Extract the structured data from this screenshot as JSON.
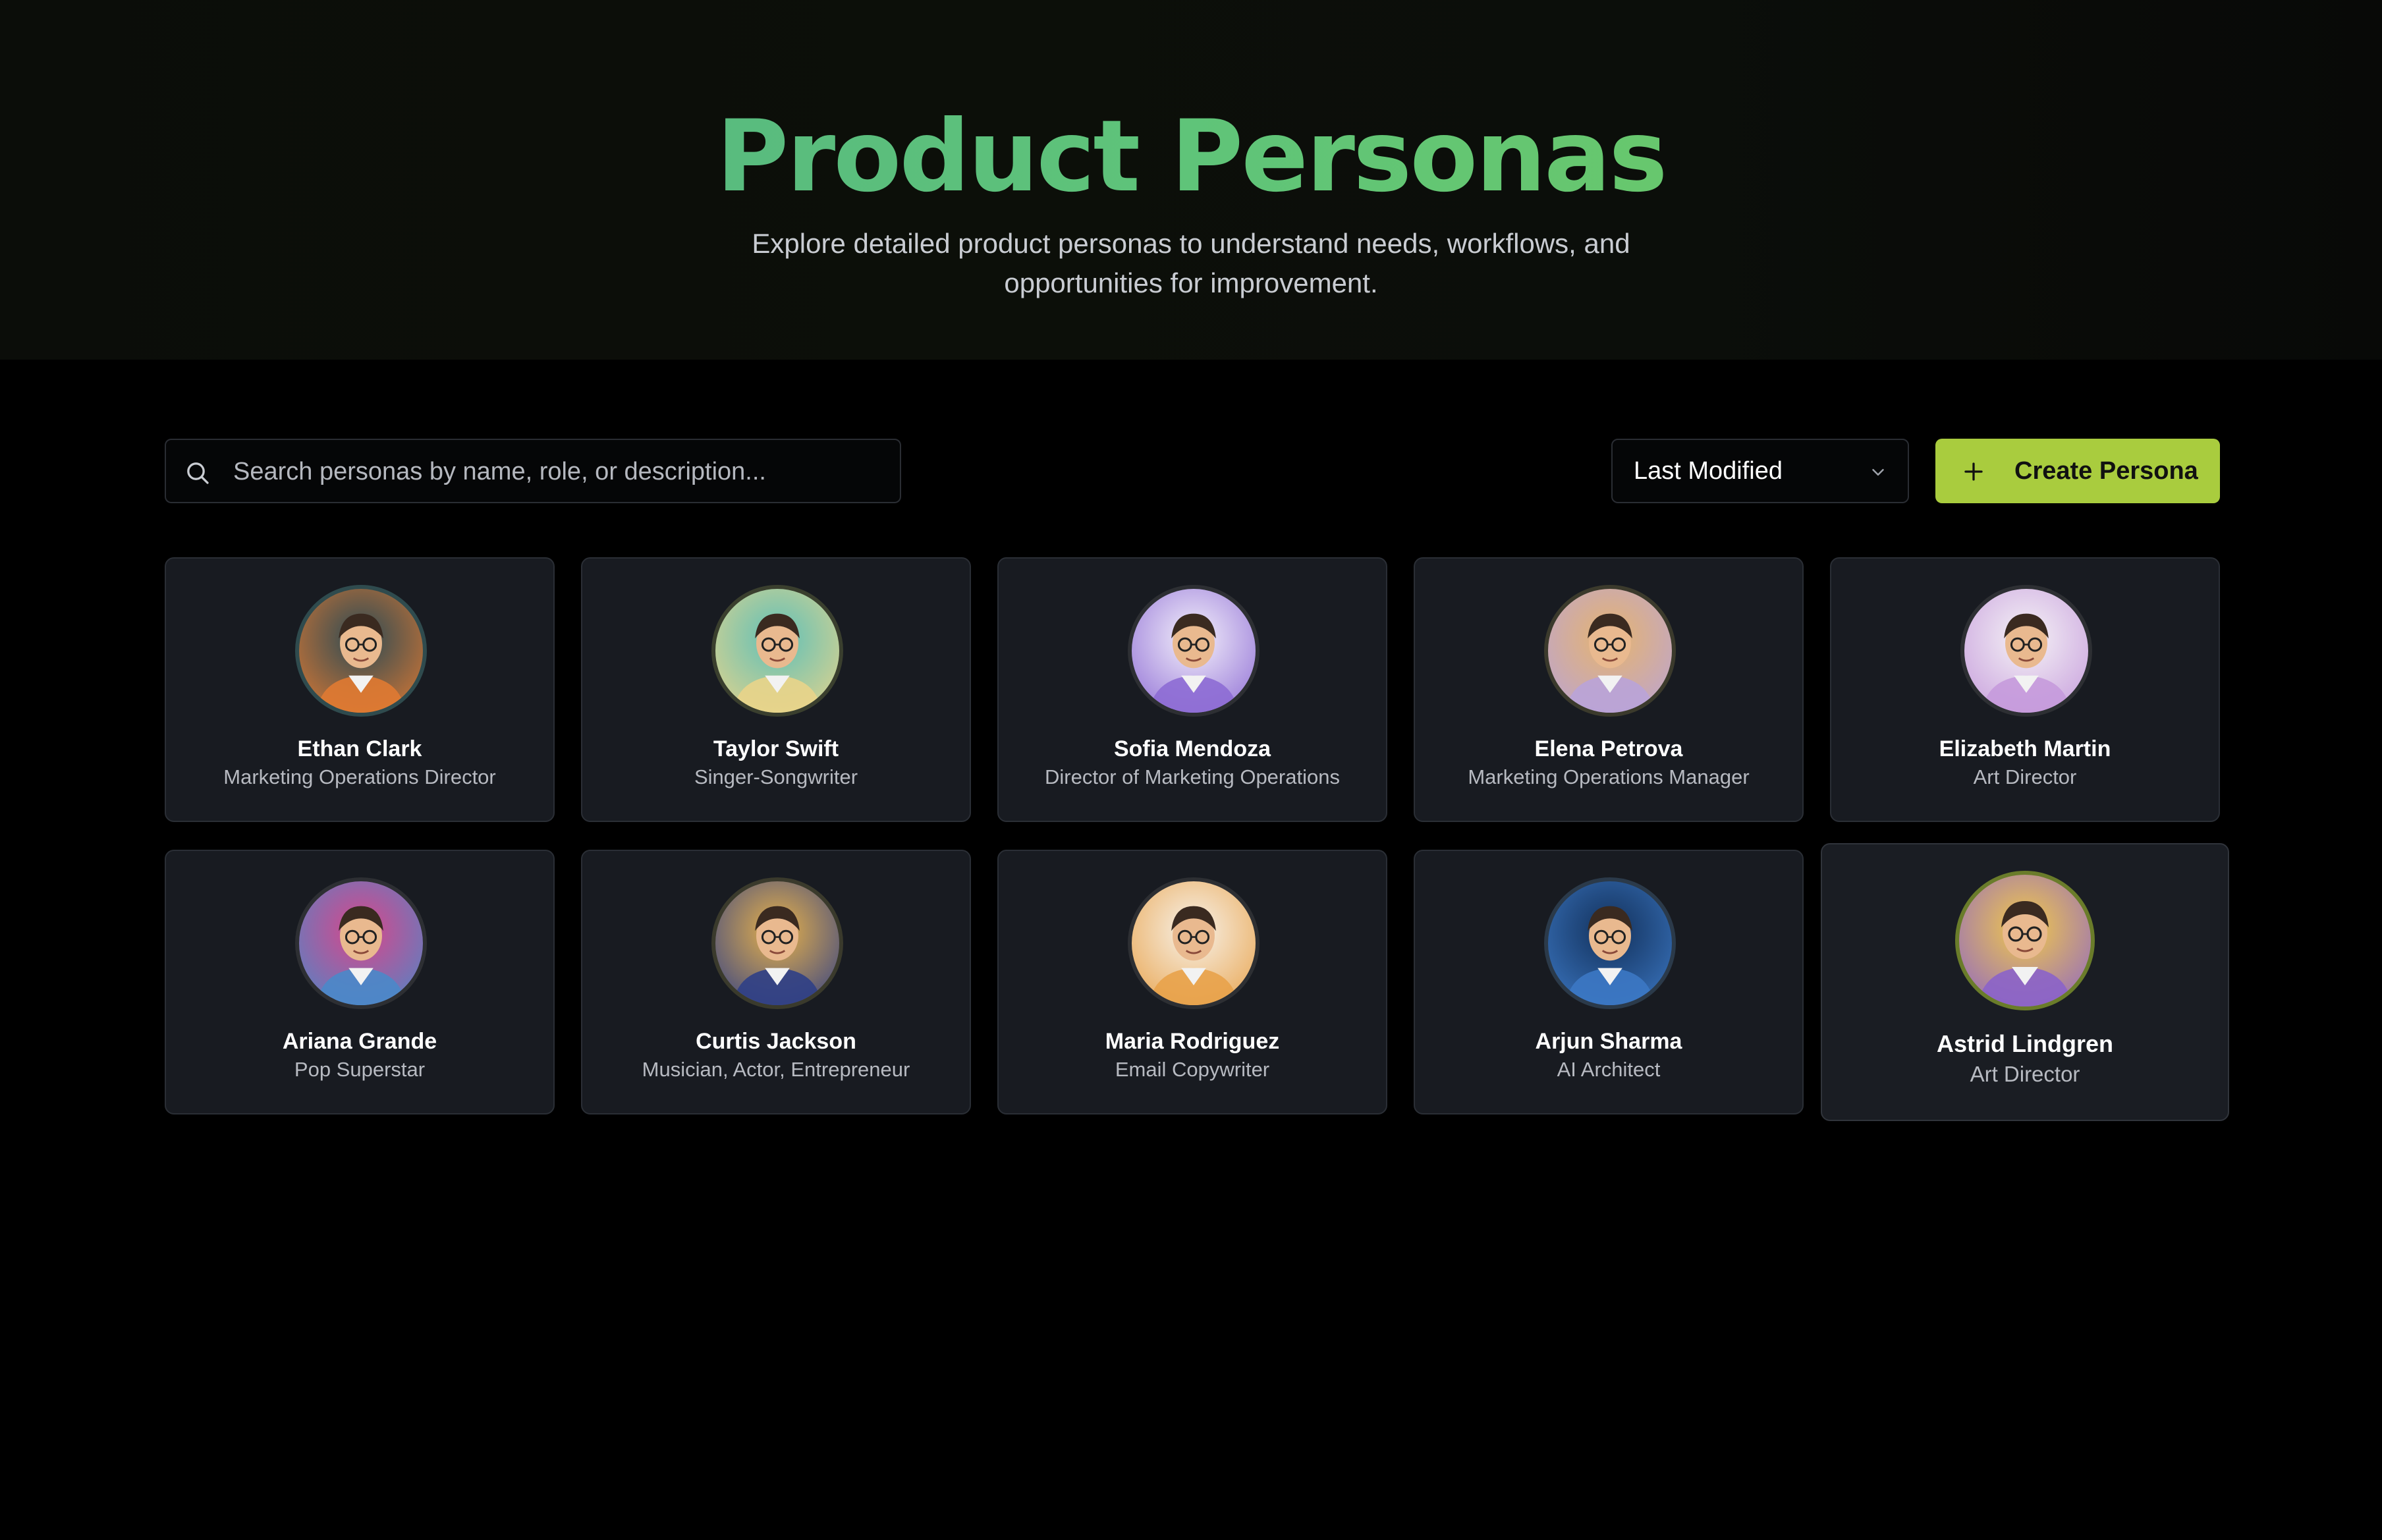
{
  "header": {
    "title": "Product Personas",
    "subtitle": "Explore detailed product personas to understand needs, workflows, and opportunities for improvement."
  },
  "search": {
    "placeholder": "Search personas by name, role, or description...",
    "icon": "search-icon"
  },
  "sort": {
    "selected": "Last Modified",
    "icon": "chevron-down-icon"
  },
  "create_button": {
    "label": "Create Persona",
    "icon": "plus-icon",
    "color": "#a9cc3e"
  },
  "personas": [
    {
      "name": "Ethan Clark",
      "role": "Marketing Operations Director",
      "avatar_colors": [
        "#2b4a54",
        "#e07a32"
      ],
      "ring": "#2f4b4e"
    },
    {
      "name": "Taylor Swift",
      "role": "Singer-Songwriter",
      "avatar_colors": [
        "#5fc0b8",
        "#e9d48a"
      ],
      "ring": "#3a3f2e"
    },
    {
      "name": "Sofia Mendoza",
      "role": "Director of Marketing Operations",
      "avatar_colors": [
        "#f4f1fb",
        "#8d6bd4"
      ],
      "ring": "#2d2f33"
    },
    {
      "name": "Elena Petrova",
      "role": "Marketing Operations Manager",
      "avatar_colors": [
        "#e6b46e",
        "#b9a3d8"
      ],
      "ring": "#3b3a2c"
    },
    {
      "name": "Elizabeth Martin",
      "role": "Art Director",
      "avatar_colors": [
        "#f5f3f6",
        "#c59adb"
      ],
      "ring": "#2d2f33"
    },
    {
      "name": "Ariana Grande",
      "role": "Pop Superstar",
      "avatar_colors": [
        "#d9468a",
        "#4a88c9"
      ],
      "ring": "#2d2f33"
    },
    {
      "name": "Curtis Jackson",
      "role": "Musician, Actor, Entrepreneur",
      "avatar_colors": [
        "#e8b24a",
        "#2f3f86"
      ],
      "ring": "#3a3a2c"
    },
    {
      "name": "Maria Rodriguez",
      "role": "Email Copywriter",
      "avatar_colors": [
        "#f7f2ea",
        "#e8a24a"
      ],
      "ring": "#2d2f33"
    },
    {
      "name": "Arjun Sharma",
      "role": "AI Architect",
      "avatar_colors": [
        "#12305a",
        "#3c78c4"
      ],
      "ring": "#2b3a4a"
    },
    {
      "name": "Astrid Lindgren",
      "role": "Art Director",
      "avatar_colors": [
        "#f2c94a",
        "#8b63c9"
      ],
      "ring": "#6a7c2a"
    }
  ]
}
